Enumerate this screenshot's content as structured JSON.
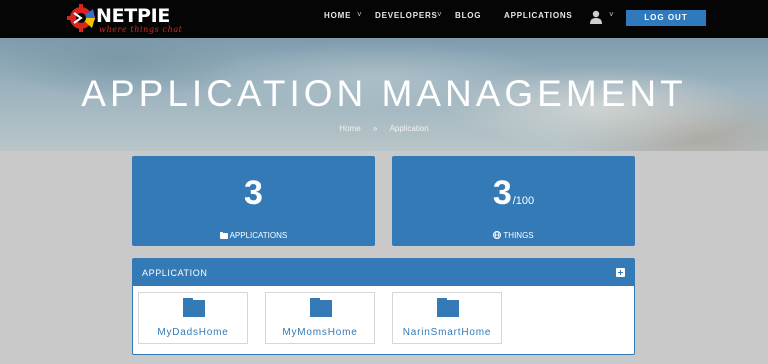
{
  "brand": {
    "name": "NETPIE",
    "tagline": "where things chat"
  },
  "nav": {
    "items": [
      "HOME",
      "DEVELOPERS",
      "BLOG",
      "APPLICATIONS"
    ],
    "logout_label": "LOG OUT"
  },
  "hero": {
    "title": "APPLICATION MANAGEMENT",
    "breadcrumb": [
      "Home",
      "»",
      "Application"
    ]
  },
  "stats": {
    "applications": {
      "value": "3",
      "label": "APPLICATIONS"
    },
    "things": {
      "value": "3",
      "suffix": "/100",
      "label": "THINGS"
    }
  },
  "panel": {
    "title": "APPLICATION",
    "apps": [
      "MyDadsHome",
      "MyMomsHome",
      "NarinSmartHome"
    ]
  },
  "colors": {
    "accent": "#337ab7",
    "topbar": "#050505",
    "page_bg": "#c9c9c9"
  },
  "icons": {
    "user": "user-icon",
    "applications": "folder-icon",
    "things": "globe-icon",
    "add": "plus-square-icon"
  }
}
